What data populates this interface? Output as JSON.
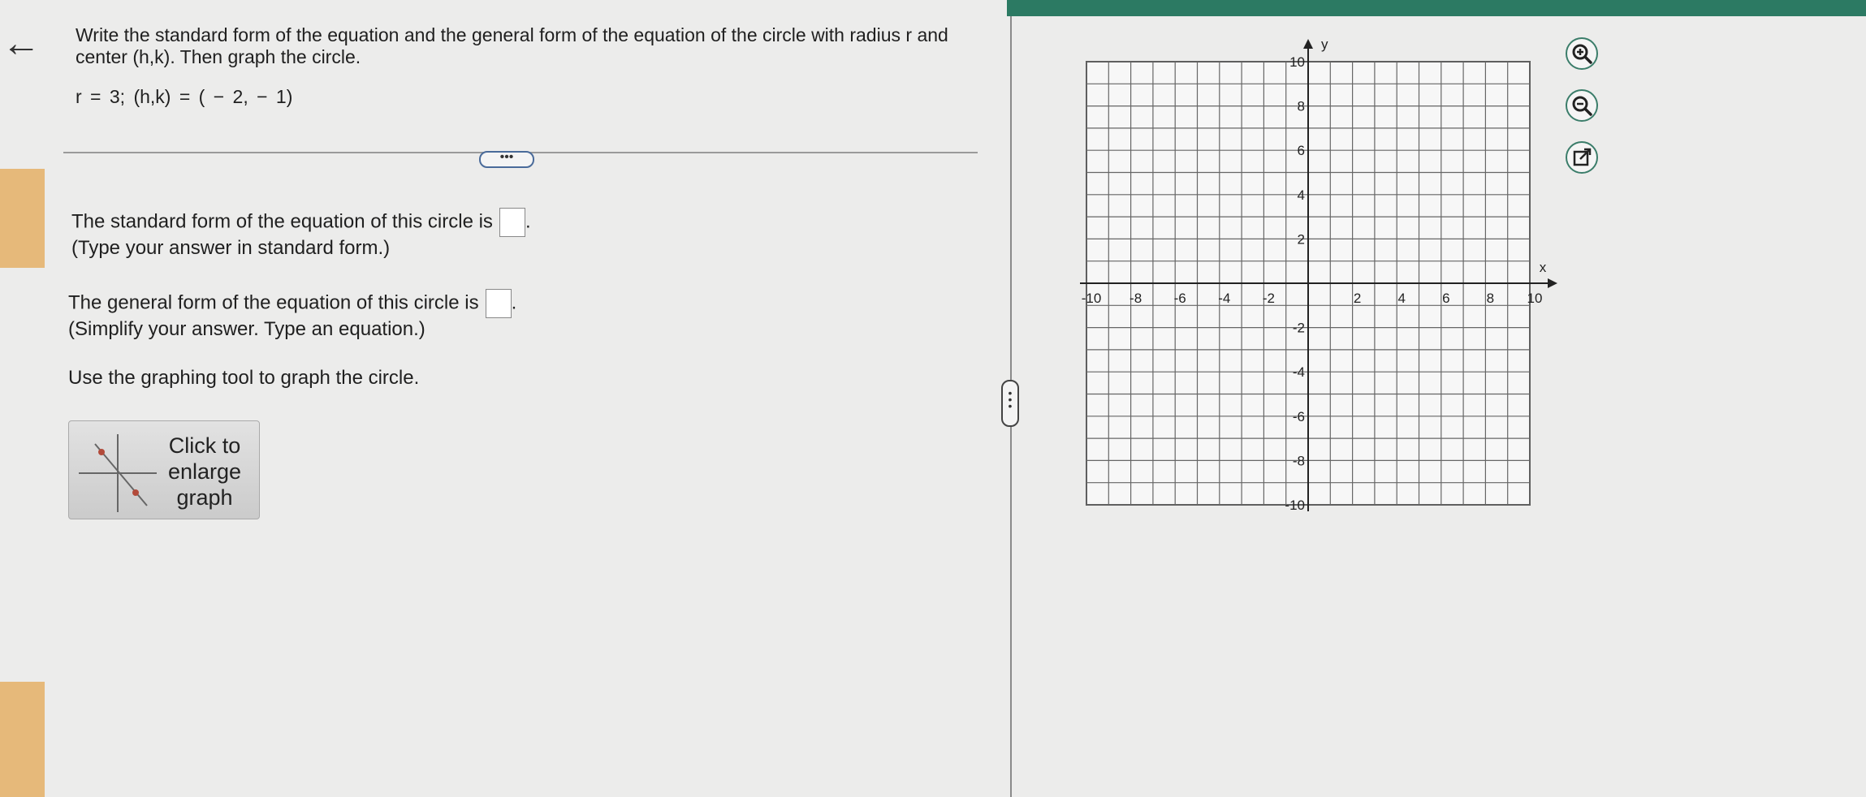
{
  "question": {
    "prompt": "Write the standard form of the equation and the general form of the equation of the circle with radius r and center (h,k). Then graph the circle.",
    "given": "r = 3;    (h,k) = ( − 2, − 1)"
  },
  "answers": {
    "standard_text": "The standard form of the equation of this circle is",
    "standard_hint": "(Type your answer in standard form.)",
    "general_text": "The general form of the equation of this circle is",
    "general_hint": "(Simplify your answer. Type an equation.)",
    "graph_instruction": "Use the graphing tool to graph the circle.",
    "period": "."
  },
  "enlarge_button": {
    "line1": "Click to",
    "line2": "enlarge",
    "line3": "graph"
  },
  "graph": {
    "x_label": "x",
    "y_label": "y",
    "x_ticks": [
      "-10",
      "-8",
      "-6",
      "-4",
      "-2",
      "2",
      "4",
      "6",
      "8",
      "10"
    ],
    "y_ticks": [
      "10",
      "8",
      "6",
      "4",
      "2",
      "-2",
      "-4",
      "-6",
      "-8",
      "-10"
    ],
    "x_range": [
      -10,
      10
    ],
    "y_range": [
      -10,
      10
    ],
    "grid_step": 1,
    "grid": true
  },
  "tools": {
    "zoom_in_icon": "zoom-in-icon",
    "zoom_out_icon": "zoom-out-icon",
    "popout_icon": "external-link-icon"
  },
  "colors": {
    "accent_green": "#2c7a63",
    "button_border": "#4a6b9a"
  }
}
